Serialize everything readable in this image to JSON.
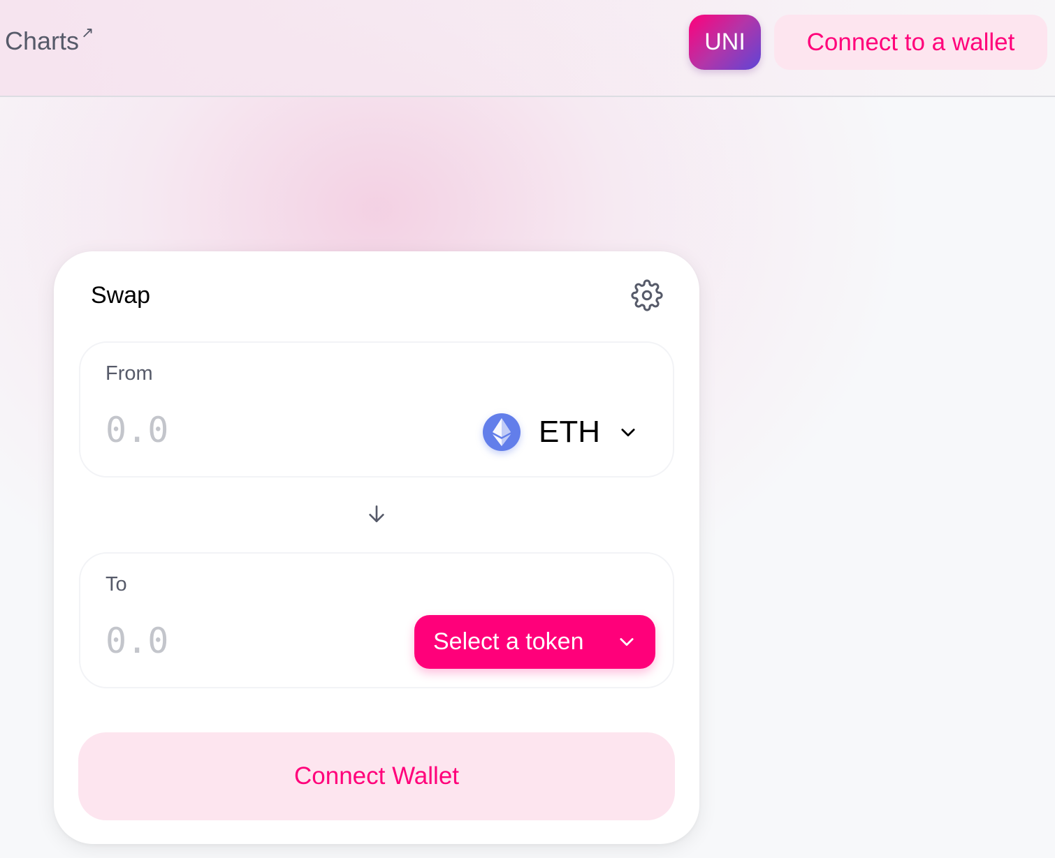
{
  "header": {
    "charts_label": "Charts",
    "charts_external_glyph": "↗",
    "uni_badge": "UNI",
    "connect_label": "Connect to a wallet"
  },
  "swap": {
    "title": "Swap",
    "settings_icon": "gear-icon",
    "from": {
      "label": "From",
      "placeholder": "0.0",
      "token": "ETH",
      "token_icon": "ethereum-icon"
    },
    "switch_icon": "arrow-down-icon",
    "to": {
      "label": "To",
      "placeholder": "0.0",
      "select_label": "Select a token"
    },
    "connect_wallet_label": "Connect Wallet"
  },
  "colors": {
    "brand_pink": "#ff007a",
    "pink_soft": "#fde5ef",
    "text_gray": "#565a69",
    "placeholder_gray": "#c3c5cb",
    "eth_blue": "#627eea"
  }
}
